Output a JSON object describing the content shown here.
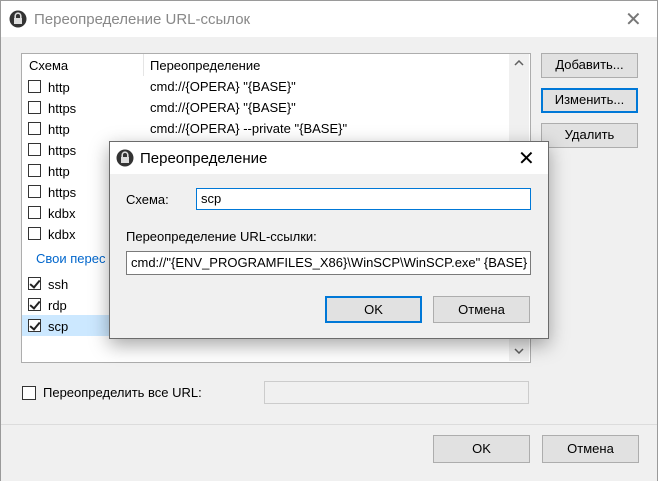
{
  "outer": {
    "title": "Переопределение URL-ссылок",
    "buttons": {
      "add": "Добавить...",
      "edit": "Изменить...",
      "delete": "Удалить",
      "ok": "OK",
      "cancel": "Отмена"
    },
    "list": {
      "col_scheme": "Схема",
      "col_override": "Переопределение",
      "rows": [
        {
          "scheme": "http",
          "value": "cmd://{OPERA} \"{BASE}\"",
          "checked": false
        },
        {
          "scheme": "https",
          "value": "cmd://{OPERA} \"{BASE}\"",
          "checked": false
        },
        {
          "scheme": "http",
          "value": "cmd://{OPERA} --private \"{BASE}\"",
          "checked": false
        },
        {
          "scheme": "https",
          "value": "",
          "checked": false
        },
        {
          "scheme": "http",
          "value": "",
          "checked": false
        },
        {
          "scheme": "https",
          "value": "",
          "checked": false
        },
        {
          "scheme": "kdbx",
          "value": "",
          "checked": false
        },
        {
          "scheme": "kdbx",
          "value": "",
          "checked": false
        }
      ],
      "group_label": "Свои перес",
      "custom_rows": [
        {
          "scheme": "ssh",
          "checked": true
        },
        {
          "scheme": "rdp",
          "checked": true
        },
        {
          "scheme": "scp",
          "checked": true,
          "selected": true
        }
      ]
    },
    "override_all_label": "Переопределить все URL:",
    "override_all_value": ""
  },
  "dialog": {
    "title": "Переопределение",
    "scheme_label": "Схема:",
    "scheme_value": "scp",
    "override_label": "Переопределение URL-ссылки:",
    "override_value": "cmd://\"{ENV_PROGRAMFILES_X86}\\WinSCP\\WinSCP.exe\" {BASE}",
    "ok": "OK",
    "cancel": "Отмена"
  },
  "colors": {
    "accent": "#0078d7",
    "selected_row": "#cce8ff",
    "link_blue": "#0066cc"
  }
}
